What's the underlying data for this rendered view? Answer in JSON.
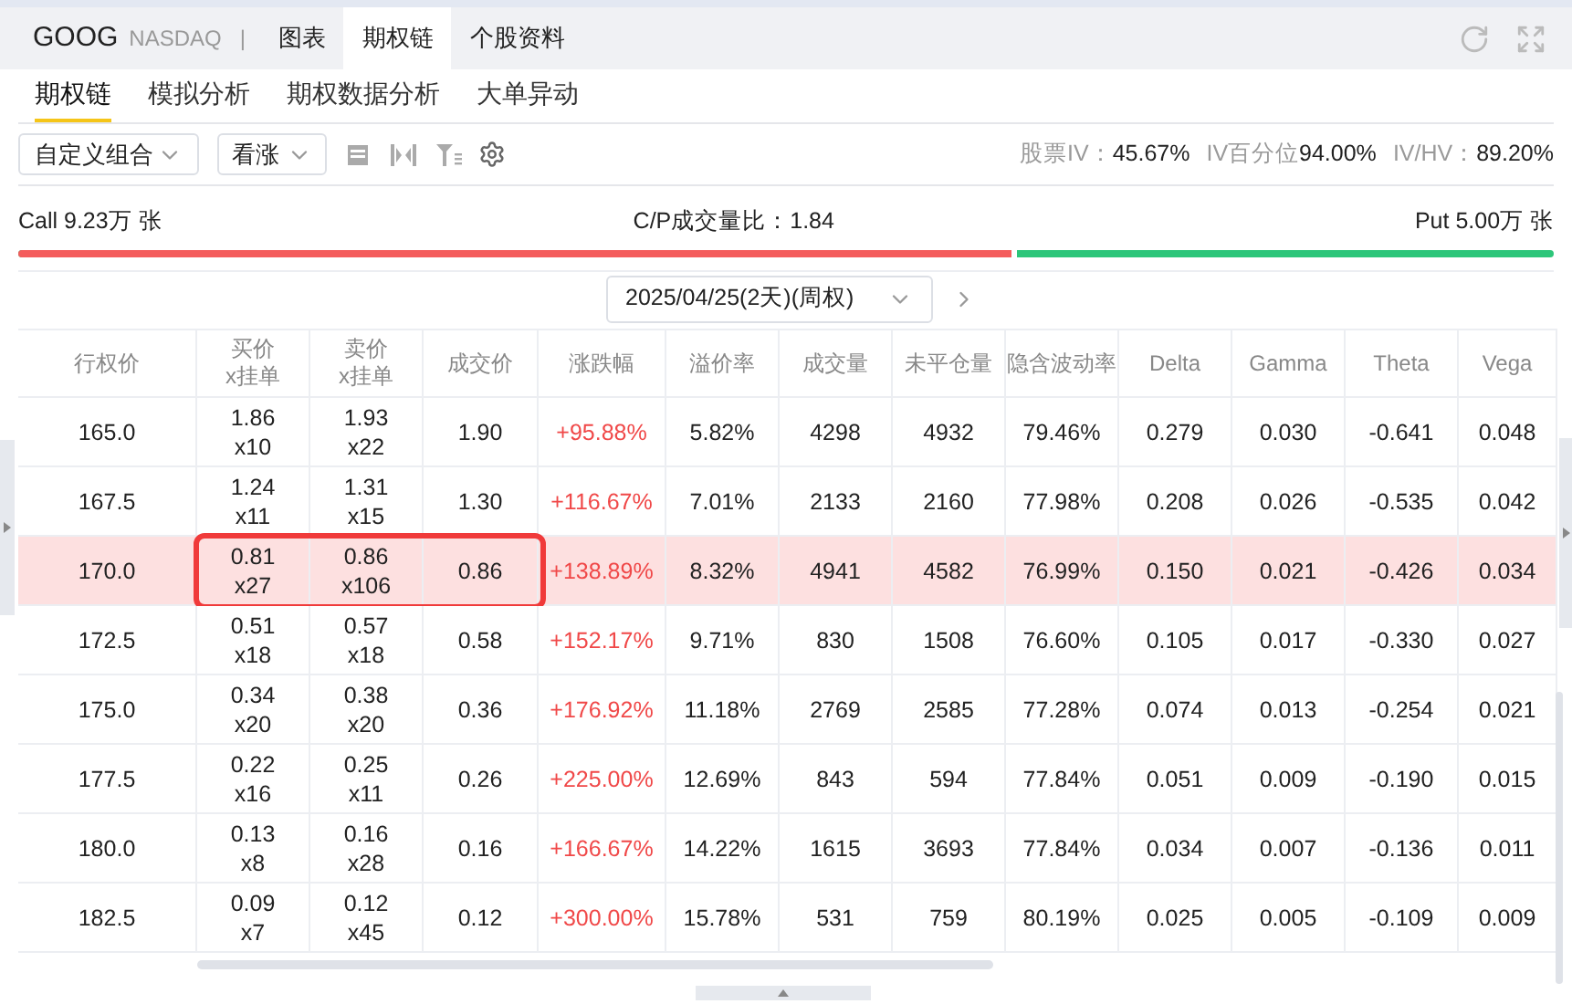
{
  "header": {
    "symbol": "GOOG",
    "exchange": "NASDAQ",
    "separator": "|",
    "tabs": [
      {
        "label": "图表",
        "selected": false
      },
      {
        "label": "期权链",
        "selected": true
      },
      {
        "label": "个股资料",
        "selected": false
      }
    ]
  },
  "subtabs": [
    {
      "label": "期权链",
      "selected": true
    },
    {
      "label": "模拟分析",
      "selected": false
    },
    {
      "label": "期权数据分析",
      "selected": false
    },
    {
      "label": "大单异动",
      "selected": false
    }
  ],
  "toolbar": {
    "combo_select": "自定义组合",
    "direction_select": "看涨",
    "stats": [
      {
        "label": "股票IV：",
        "value": "45.67%"
      },
      {
        "label": "IV百分位",
        "value": "94.00%"
      },
      {
        "label": "IV/HV：",
        "value": "89.20%"
      }
    ]
  },
  "volume_ratio": {
    "call": "Call 9.23万 张",
    "ratio": "C/P成交量比：1.84",
    "put": "Put 5.00万 张",
    "level": 0.65
  },
  "expiry": {
    "value": "2025/04/25(2天)(周权)"
  },
  "table": {
    "columns": [
      {
        "label": "行权价"
      },
      {
        "label": "买价",
        "sublabel": "x挂单"
      },
      {
        "label": "卖价",
        "sublabel": "x挂单"
      },
      {
        "label": "成交价"
      },
      {
        "label": "涨跌幅"
      },
      {
        "label": "溢价率"
      },
      {
        "label": "成交量"
      },
      {
        "label": "未平仓量"
      },
      {
        "label": "隐含波动率"
      },
      {
        "label": "Delta"
      },
      {
        "label": "Gamma"
      },
      {
        "label": "Theta"
      },
      {
        "label": "Vega"
      }
    ],
    "rows": [
      {
        "strike": "165.0",
        "bid": "1.86",
        "bid_size": "x10",
        "ask": "1.93",
        "ask_size": "x22",
        "last": "1.90",
        "change": "+95.88%",
        "premium": "5.82%",
        "volume": "4298",
        "open_interest": "4932",
        "iv": "79.46%",
        "delta": "0.279",
        "gamma": "0.030",
        "theta": "-0.641",
        "vega": "0.048",
        "selected": false,
        "boxed": false
      },
      {
        "strike": "167.5",
        "bid": "1.24",
        "bid_size": "x11",
        "ask": "1.31",
        "ask_size": "x15",
        "last": "1.30",
        "change": "+116.67%",
        "premium": "7.01%",
        "volume": "2133",
        "open_interest": "2160",
        "iv": "77.98%",
        "delta": "0.208",
        "gamma": "0.026",
        "theta": "-0.535",
        "vega": "0.042",
        "selected": false,
        "boxed": false
      },
      {
        "strike": "170.0",
        "bid": "0.81",
        "bid_size": "x27",
        "ask": "0.86",
        "ask_size": "x106",
        "last": "0.86",
        "change": "+138.89%",
        "premium": "8.32%",
        "volume": "4941",
        "open_interest": "4582",
        "iv": "76.99%",
        "delta": "0.150",
        "gamma": "0.021",
        "theta": "-0.426",
        "vega": "0.034",
        "selected": true,
        "boxed": true
      },
      {
        "strike": "172.5",
        "bid": "0.51",
        "bid_size": "x18",
        "ask": "0.57",
        "ask_size": "x18",
        "last": "0.58",
        "change": "+152.17%",
        "premium": "9.71%",
        "volume": "830",
        "open_interest": "1508",
        "iv": "76.60%",
        "delta": "0.105",
        "gamma": "0.017",
        "theta": "-0.330",
        "vega": "0.027",
        "selected": false,
        "boxed": false
      },
      {
        "strike": "175.0",
        "bid": "0.34",
        "bid_size": "x20",
        "ask": "0.38",
        "ask_size": "x20",
        "last": "0.36",
        "change": "+176.92%",
        "premium": "11.18%",
        "volume": "2769",
        "open_interest": "2585",
        "iv": "77.28%",
        "delta": "0.074",
        "gamma": "0.013",
        "theta": "-0.254",
        "vega": "0.021",
        "selected": false,
        "boxed": false
      },
      {
        "strike": "177.5",
        "bid": "0.22",
        "bid_size": "x16",
        "ask": "0.25",
        "ask_size": "x11",
        "last": "0.26",
        "change": "+225.00%",
        "premium": "12.69%",
        "volume": "843",
        "open_interest": "594",
        "iv": "77.84%",
        "delta": "0.051",
        "gamma": "0.009",
        "theta": "-0.190",
        "vega": "0.015",
        "selected": false,
        "boxed": false
      },
      {
        "strike": "180.0",
        "bid": "0.13",
        "bid_size": "x8",
        "ask": "0.16",
        "ask_size": "x28",
        "last": "0.16",
        "change": "+166.67%",
        "premium": "14.22%",
        "volume": "1615",
        "open_interest": "3693",
        "iv": "77.84%",
        "delta": "0.034",
        "gamma": "0.007",
        "theta": "-0.136",
        "vega": "0.011",
        "selected": false,
        "boxed": false
      },
      {
        "strike": "182.5",
        "bid": "0.09",
        "bid_size": "x7",
        "ask": "0.12",
        "ask_size": "x45",
        "last": "0.12",
        "change": "+300.00%",
        "premium": "15.78%",
        "volume": "531",
        "open_interest": "759",
        "iv": "80.19%",
        "delta": "0.025",
        "gamma": "0.005",
        "theta": "-0.109",
        "vega": "0.009",
        "selected": false,
        "boxed": false
      }
    ]
  }
}
